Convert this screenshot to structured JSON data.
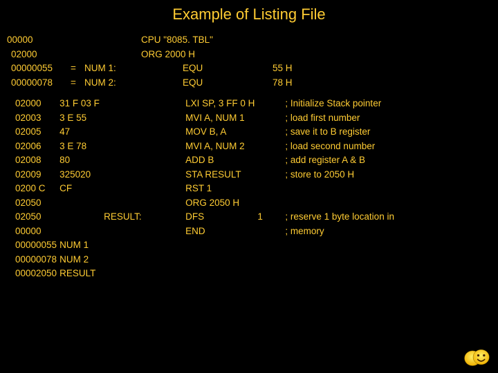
{
  "title": "Example of Listing File",
  "rows": [
    {
      "addr": "00000",
      "hex": "",
      "eq": "",
      "label": "",
      "instr": "CPU \"8085. TBL\"",
      "val": "",
      "comment": ""
    },
    {
      "addr": "02000",
      "hex": "",
      "eq": "",
      "label": "",
      "instr": "ORG 2000 H",
      "val": "",
      "comment": ""
    },
    {
      "addr": "00000055",
      "hex": "",
      "eq": "=",
      "label": "NUM 1:",
      "instr": "EQU",
      "val": "55 H",
      "comment": ""
    },
    {
      "addr": "00000078",
      "hex": "",
      "eq": "=",
      "label": "NUM 2:",
      "instr": "EQU",
      "val": "78 H",
      "comment": ""
    }
  ],
  "rows2": [
    {
      "addr": "02000",
      "hex": "31 F 03 F",
      "label": "",
      "instr": "LXI SP, 3 FF 0 H",
      "val": "",
      "comment": "; Initialize Stack pointer"
    },
    {
      "addr": "02003",
      "hex": "3 E 55",
      "label": "",
      "instr": "MVI A, NUM 1",
      "val": "",
      "comment": "; load first number"
    },
    {
      "addr": "02005",
      "hex": "47",
      "label": "",
      "instr": "MOV B, A",
      "val": "",
      "comment": "; save it to B register"
    },
    {
      "addr": "02006",
      "hex": "3 E 78",
      "label": "",
      "instr": "MVI A, NUM 2",
      "val": "",
      "comment": "; load second number"
    },
    {
      "addr": "02008",
      "hex": "80",
      "label": "",
      "instr": "ADD B",
      "val": "",
      "comment": "; add register A & B"
    },
    {
      "addr": "02009",
      "hex": "325020",
      "label": "",
      "instr": "STA RESULT",
      "val": "",
      "comment": "; store to 2050 H"
    },
    {
      "addr": "0200 C",
      "hex": "CF",
      "label": "",
      "instr": "RST 1",
      "val": "",
      "comment": ""
    },
    {
      "addr": "02050",
      "hex": "",
      "label": "",
      "instr": "ORG 2050 H",
      "val": "",
      "comment": ""
    },
    {
      "addr": "02050",
      "hex": "",
      "label": "RESULT:",
      "instr": "DFS",
      "val": "1",
      "comment": "; reserve 1 byte location in"
    },
    {
      "addr": "00000",
      "hex": "",
      "label": "",
      "instr": "END",
      "val": "",
      "comment": "; memory"
    },
    {
      "addr": "00000055",
      "hex": "NUM 1",
      "label": "",
      "instr": "",
      "val": "",
      "comment": ""
    },
    {
      "addr": "00000078",
      "hex": "NUM 2",
      "label": "",
      "instr": "",
      "val": "",
      "comment": ""
    },
    {
      "addr": "00002050",
      "hex": "RESULT",
      "label": "",
      "instr": "",
      "val": "",
      "comment": ""
    }
  ],
  "smiley_name": "smiley-icon"
}
